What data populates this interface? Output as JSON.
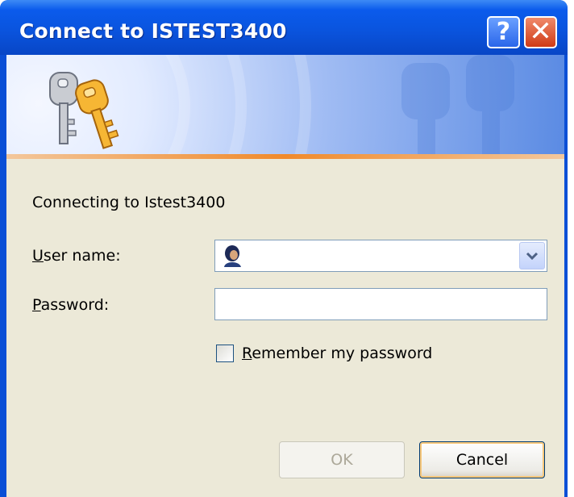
{
  "window": {
    "title": "Connect to ISTEST3400",
    "help_glyph": "?",
    "close_glyph": "✕"
  },
  "dialog": {
    "message": "Connecting to Istest3400",
    "username_label_access": "U",
    "username_label_rest": "ser name:",
    "username_value": "",
    "password_label_access": "P",
    "password_label_rest": "assword:",
    "password_value": "",
    "remember_access": "R",
    "remember_rest": "emember my password",
    "remember_checked": false
  },
  "buttons": {
    "ok_label": "OK",
    "cancel_label": "Cancel"
  },
  "colors": {
    "titlebar": "#0a54de",
    "dialog_bg": "#ece9d8",
    "accent_orange": "#f08a2b"
  },
  "icons": [
    "help-icon",
    "close-icon",
    "keys-icon",
    "user-avatar-icon",
    "chevron-down-icon"
  ]
}
